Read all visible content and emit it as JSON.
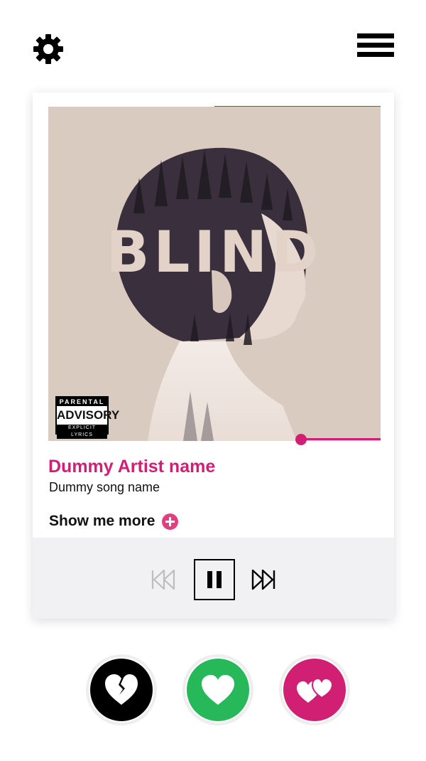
{
  "header": {
    "settings_icon": "gear-icon",
    "menu_icon": "hamburger-menu-icon"
  },
  "album": {
    "cover_title": "BLIND",
    "advisory": {
      "line1": "PARENTAL",
      "line2": "ADVISORY",
      "line3": "EXPLICIT LYRICS"
    }
  },
  "track": {
    "artist": "Dummy Artist name",
    "song": "Dummy song name",
    "show_more_label": "Show me more",
    "show_more_icon": "plus-circle-icon"
  },
  "player": {
    "prev_icon": "skip-previous-icon",
    "pause_icon": "pause-icon",
    "next_icon": "skip-next-icon",
    "prev_enabled": false
  },
  "actions": [
    {
      "name": "dislike",
      "icon": "broken-heart-icon",
      "color": "#000000"
    },
    {
      "name": "like",
      "icon": "heart-icon",
      "color": "#27b85a"
    },
    {
      "name": "love",
      "icon": "double-heart-icon",
      "color": "#d11f74"
    }
  ],
  "colors": {
    "accent": "#d11f74",
    "plus": "#e0407f",
    "like": "#27b85a",
    "cover_bg": "#d9cbbf",
    "controls_bg": "#f1f1f3"
  }
}
